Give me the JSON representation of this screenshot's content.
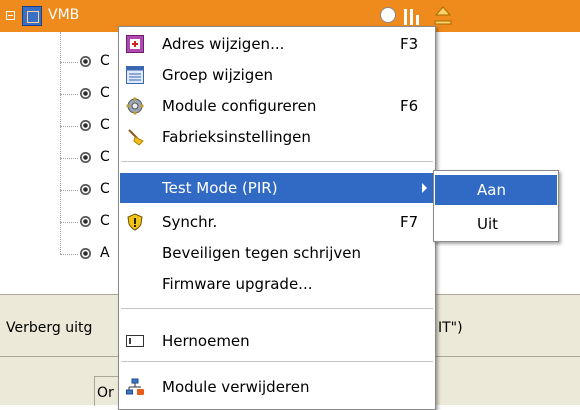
{
  "tree": {
    "root_label": "VMB",
    "children_visible_initials": [
      "C",
      "C",
      "C",
      "C",
      "C",
      "C",
      "A"
    ]
  },
  "panel": {
    "left_text": "Verberg uitg",
    "right_text": "IT\")"
  },
  "status": {
    "cell_text": "Or"
  },
  "context_menu": {
    "items": [
      {
        "label": "Adres wijzigen...",
        "shortcut": "F3",
        "icon": "address-edit-icon"
      },
      {
        "label": "Groep wijzigen",
        "shortcut": "",
        "icon": "group-list-icon"
      },
      {
        "label": "Module configureren",
        "shortcut": "F6",
        "icon": "gear-config-icon"
      },
      {
        "label": "Fabrieksinstellingen",
        "shortcut": "",
        "icon": "broom-icon"
      },
      {
        "label": "Test Mode (PIR)",
        "shortcut": "",
        "icon": "",
        "selected": true,
        "has_submenu": true
      },
      {
        "label": "Synchr.",
        "shortcut": "F7",
        "icon": "shield-sync-icon"
      },
      {
        "label": "Beveiligen tegen schrijven",
        "shortcut": "",
        "icon": ""
      },
      {
        "label": "Firmware upgrade...",
        "shortcut": "",
        "icon": ""
      },
      {
        "label": "Hernoemen",
        "shortcut": "",
        "icon": "rename-field-icon"
      },
      {
        "label": "Module verwijderen",
        "shortcut": "",
        "icon": "network-remove-icon"
      }
    ]
  },
  "submenu": {
    "items": [
      {
        "label": "Aan",
        "selected": true
      },
      {
        "label": "Uit",
        "selected": false
      }
    ]
  },
  "colors": {
    "header_bar": "#ef8a1c",
    "selection": "#316ac5",
    "panel_bg": "#ece9d8"
  }
}
